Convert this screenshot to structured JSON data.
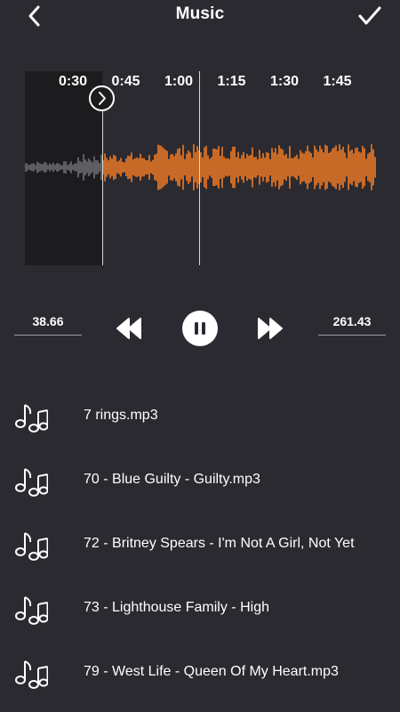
{
  "header": {
    "title": "Music",
    "back_icon": "chevron-left-icon",
    "confirm_icon": "checkmark-icon"
  },
  "waveform": {
    "time_ticks": [
      {
        "label": "0:30",
        "seconds": 30
      },
      {
        "label": "0:45",
        "seconds": 45
      },
      {
        "label": "1:00",
        "seconds": 60
      },
      {
        "label": "1:15",
        "seconds": 75
      },
      {
        "label": "1:30",
        "seconds": 90
      },
      {
        "label": "1:45",
        "seconds": 105
      }
    ],
    "selected_color": "#f07a25",
    "unselected_color": "#6e6e72",
    "dim_background": "#1c1c1e"
  },
  "controls": {
    "start_time": "38.66",
    "end_time": "261.43",
    "rewind_icon": "rewind-icon",
    "pause_icon": "pause-icon",
    "fast_forward_icon": "fast-forward-icon"
  },
  "songs": [
    {
      "name": "7 rings.mp3",
      "icon": "music-notes-icon"
    },
    {
      "name": "70 - Blue Guilty -  Guilty.mp3",
      "icon": "music-notes-icon"
    },
    {
      "name": "72 - Britney Spears -  I'm Not A Girl, Not Yet",
      "icon": "music-notes-icon"
    },
    {
      "name": "73 - Lighthouse Family -  High",
      "icon": "music-notes-icon"
    },
    {
      "name": "79 - West Life -  Queen Of My Heart.mp3",
      "icon": "music-notes-icon"
    }
  ]
}
